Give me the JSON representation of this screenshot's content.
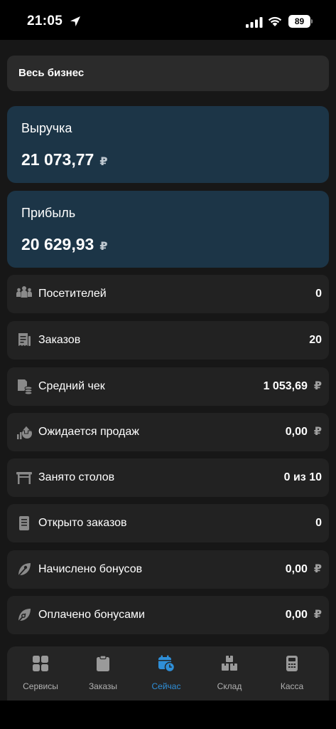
{
  "status_bar": {
    "time": "21:05",
    "battery": "89"
  },
  "business_selector": {
    "label": "Весь бизнес"
  },
  "revenue": {
    "label": "Выручка",
    "value": "21 073,77",
    "currency": "₽"
  },
  "profit": {
    "label": "Прибыль",
    "value": "20 629,93",
    "currency": "₽"
  },
  "stats": [
    {
      "label": "Посетителей",
      "value": "0",
      "currency": "",
      "icon": "visitors-icon"
    },
    {
      "label": "Заказов",
      "value": "20",
      "currency": "",
      "icon": "receipt-icon"
    },
    {
      "label": "Средний чек",
      "value": "1 053,69",
      "currency": "₽",
      "icon": "coins-icon"
    },
    {
      "label": "Ожидается продаж",
      "value": "0,00",
      "currency": "₽",
      "icon": "growth-icon"
    },
    {
      "label": "Занято столов",
      "value": "0 из 10",
      "currency": "",
      "icon": "table-icon"
    },
    {
      "label": "Открыто заказов",
      "value": "0",
      "currency": "",
      "icon": "document-icon"
    },
    {
      "label": "Начислено бонусов",
      "value": "0,00",
      "currency": "₽",
      "icon": "bonus-leaf-icon"
    },
    {
      "label": "Оплачено бонусами",
      "value": "0,00",
      "currency": "₽",
      "icon": "bonus-paid-icon"
    }
  ],
  "tabs": [
    {
      "label": "Сервисы",
      "icon": "grid-icon"
    },
    {
      "label": "Заказы",
      "icon": "clipboard-icon"
    },
    {
      "label": "Сейчас",
      "icon": "calendar-clock-icon"
    },
    {
      "label": "Склад",
      "icon": "boxes-icon"
    },
    {
      "label": "Касса",
      "icon": "cash-register-icon"
    }
  ],
  "colors": {
    "card_bg": "#1c3547",
    "accent": "#2f8fd8",
    "row_bg": "#222222"
  }
}
